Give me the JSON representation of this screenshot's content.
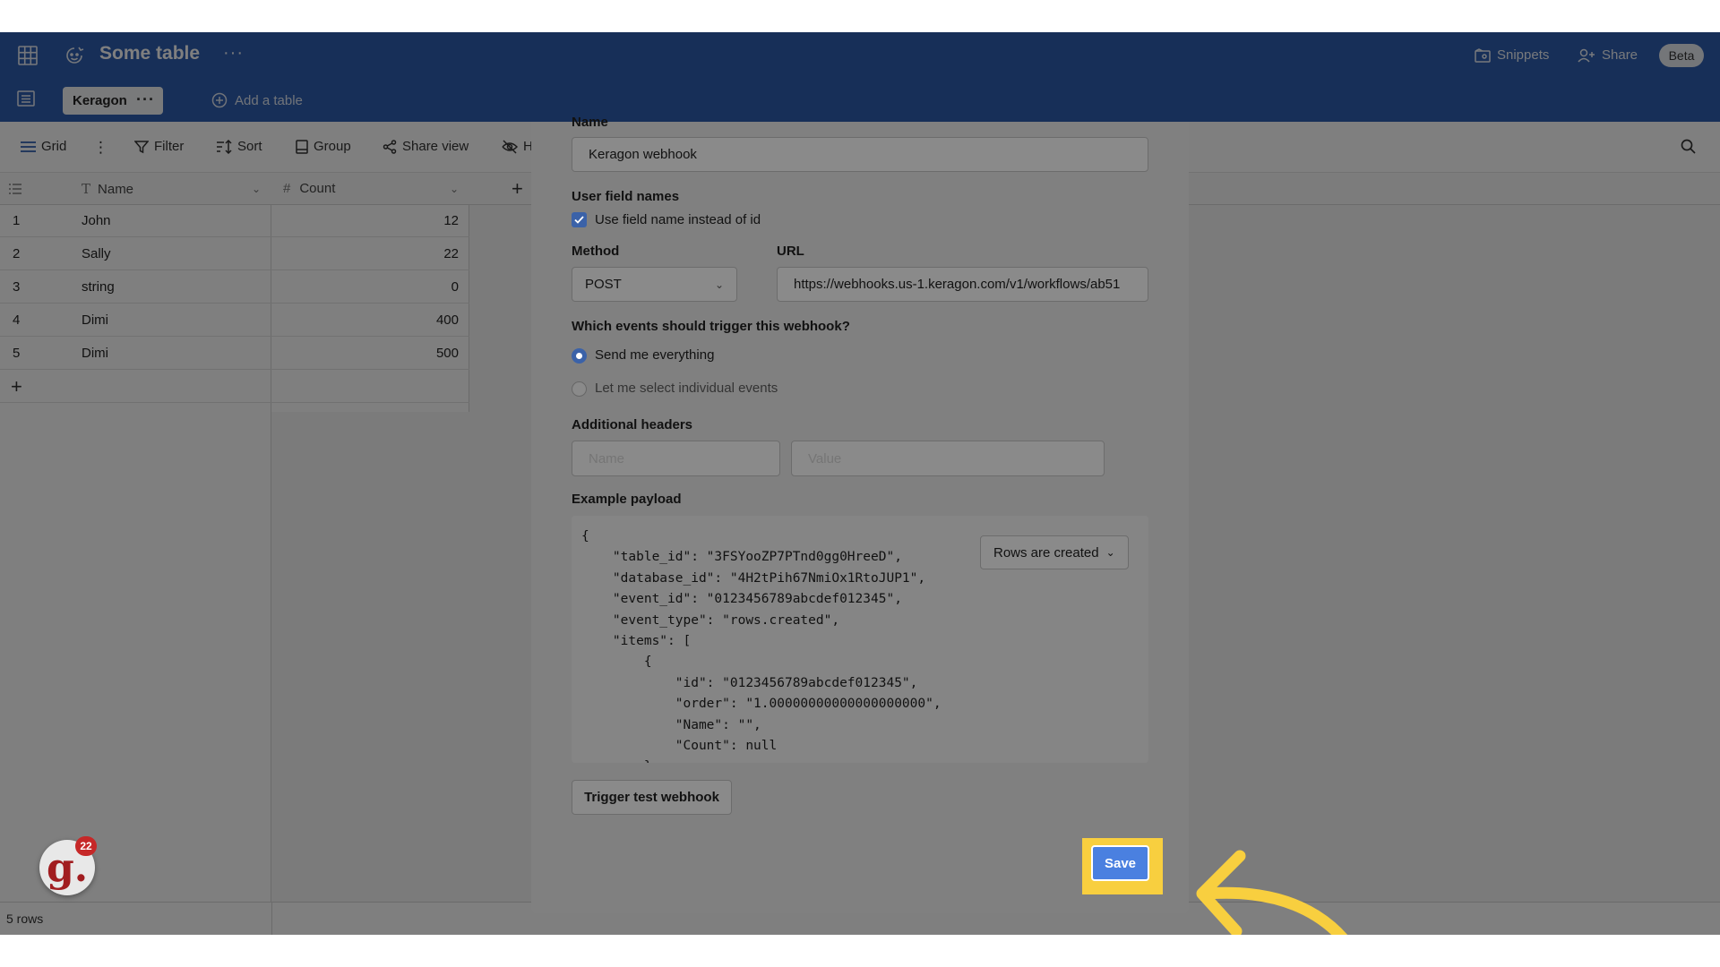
{
  "header": {
    "title": "Some table",
    "snippets_label": "Snippets",
    "share_label": "Share",
    "beta_label": "Beta",
    "active_table": "Keragon",
    "add_table_label": "Add a table"
  },
  "toolbar": {
    "grid_label": "Grid",
    "filter_label": "Filter",
    "sort_label": "Sort",
    "group_label": "Group",
    "share_view_label": "Share view",
    "hide_label": "H"
  },
  "table": {
    "columns": [
      "Name",
      "Count"
    ],
    "rows": [
      {
        "id": "1",
        "name": "John",
        "count": "12"
      },
      {
        "id": "2",
        "name": "Sally",
        "count": "22"
      },
      {
        "id": "3",
        "name": "string",
        "count": "0"
      },
      {
        "id": "4",
        "name": "Dimi",
        "count": "400"
      },
      {
        "id": "5",
        "name": "Dimi",
        "count": "500"
      }
    ],
    "row_count_label": "5 rows"
  },
  "webhook_form": {
    "name_label": "Name",
    "name_value": "Keragon webhook",
    "user_field_names_label": "User field names",
    "use_field_name_label": "Use field name instead of id",
    "method_label": "Method",
    "method_value": "POST",
    "url_label": "URL",
    "url_value": "https://webhooks.us-1.keragon.com/v1/workflows/ab51",
    "events_question": "Which events should trigger this webhook?",
    "option_everything": "Send me everything",
    "option_individual": "Let me select individual events",
    "additional_headers_label": "Additional headers",
    "header_name_placeholder": "Name",
    "header_value_placeholder": "Value",
    "example_payload_label": "Example payload",
    "payload_event_select": "Rows are created",
    "payload_text": "{\n    \"table_id\": \"3FSYooZP7PTnd0gg0HreeD\",\n    \"database_id\": \"4H2tPih67NmiOx1RtoJUP1\",\n    \"event_id\": \"0123456789abcdef012345\",\n    \"event_type\": \"rows.created\",\n    \"items\": [\n        {\n            \"id\": \"0123456789abcdef012345\",\n            \"order\": \"1.00000000000000000000\",\n            \"Name\": \"\",\n            \"Count\": null\n        }",
    "trigger_test_label": "Trigger test webhook",
    "save_label": "Save"
  },
  "notifications": {
    "avatar_letter": "g.",
    "count": "22"
  },
  "colors": {
    "header_bg": "#2f5fb0",
    "save_button": "#4a80e0",
    "highlight": "#f8cf3f"
  }
}
